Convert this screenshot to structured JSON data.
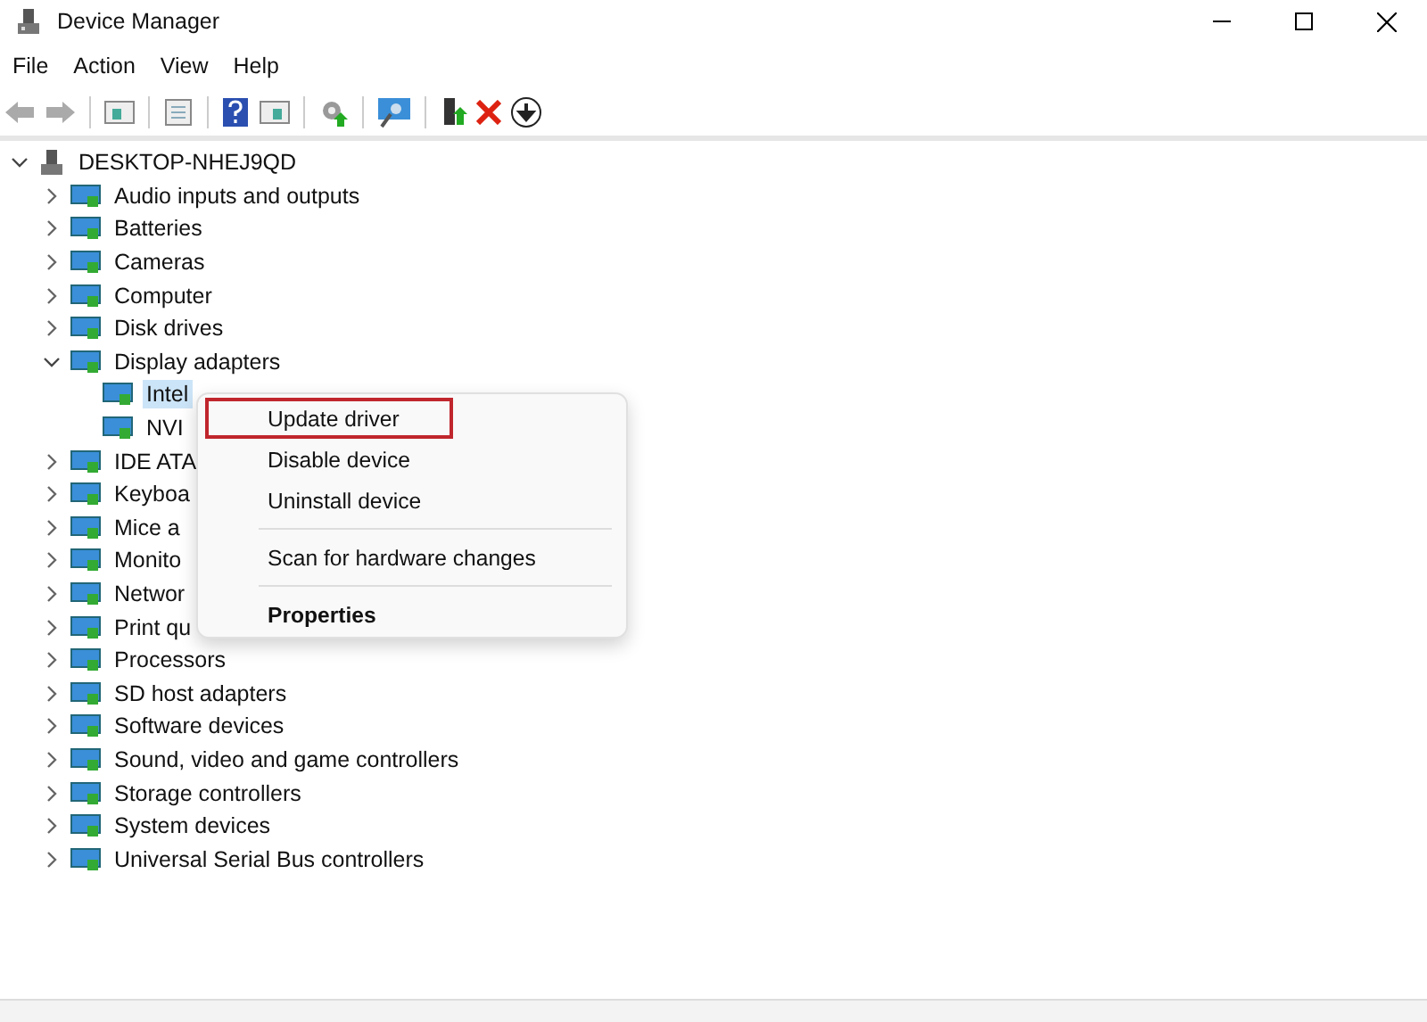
{
  "window": {
    "title": "Device Manager"
  },
  "menu_bar": [
    "File",
    "Action",
    "View",
    "Help"
  ],
  "tree": [
    {
      "label": "DESKTOP-NHEJ9QD",
      "expanded": true,
      "selected": false,
      "children": [
        {
          "label": "Audio inputs and outputs",
          "expanded": false,
          "selected": false
        },
        {
          "label": "Batteries",
          "expanded": false,
          "selected": false
        },
        {
          "label": "Cameras",
          "expanded": false,
          "selected": false
        },
        {
          "label": "Computer",
          "expanded": false,
          "selected": false
        },
        {
          "label": "Disk drives",
          "expanded": false,
          "selected": false
        },
        {
          "label": "Display adapters",
          "expanded": true,
          "selected": false,
          "children": [
            {
              "label": "Intel",
              "selected": true
            },
            {
              "label": "NVI",
              "selected": false
            }
          ]
        },
        {
          "label": "IDE ATA",
          "expanded": false,
          "selected": false
        },
        {
          "label": "Keyboa",
          "expanded": false,
          "selected": false
        },
        {
          "label": "Mice a",
          "expanded": false,
          "selected": false
        },
        {
          "label": "Monito",
          "expanded": false,
          "selected": false
        },
        {
          "label": "Networ",
          "expanded": false,
          "selected": false
        },
        {
          "label": "Print qu",
          "expanded": false,
          "selected": false
        },
        {
          "label": "Processors",
          "expanded": false,
          "selected": false
        },
        {
          "label": "SD host adapters",
          "expanded": false,
          "selected": false
        },
        {
          "label": "Software devices",
          "expanded": false,
          "selected": false
        },
        {
          "label": "Sound, video and game controllers",
          "expanded": false,
          "selected": false
        },
        {
          "label": "Storage controllers",
          "expanded": false,
          "selected": false
        },
        {
          "label": "System devices",
          "expanded": false,
          "selected": false
        },
        {
          "label": "Universal Serial Bus controllers",
          "expanded": false,
          "selected": false
        }
      ]
    }
  ],
  "context_menu": [
    {
      "kind": "item",
      "label": "Update driver",
      "highlighted": true,
      "bold": false
    },
    {
      "kind": "item",
      "label": "Disable device",
      "highlighted": false,
      "bold": false
    },
    {
      "kind": "item",
      "label": "Uninstall device",
      "highlighted": false,
      "bold": false
    },
    {
      "kind": "separator"
    },
    {
      "kind": "item",
      "label": "Scan for hardware changes",
      "highlighted": false,
      "bold": false
    },
    {
      "kind": "separator"
    },
    {
      "kind": "item",
      "label": "Properties",
      "highlighted": false,
      "bold": true
    }
  ]
}
